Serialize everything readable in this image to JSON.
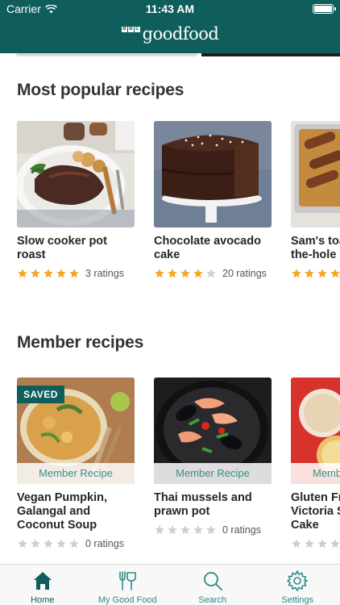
{
  "status_bar": {
    "carrier": "Carrier",
    "time": "11:43 AM"
  },
  "header": {
    "logo_bbc": [
      "B",
      "B",
      "C"
    ],
    "logo_text": "goodfood"
  },
  "sections": [
    {
      "title": "Most popular recipes",
      "cards": [
        {
          "name": "Slow cooker pot roast",
          "rating": 5,
          "ratings_text": "3 ratings"
        },
        {
          "name": "Chocolate avocado cake",
          "rating": 4,
          "ratings_text": "20 ratings"
        },
        {
          "name": "Sam's toad-in-the-hole",
          "visible_name": "Sam's toa\nthe-hole",
          "rating": 5,
          "ratings_text": ""
        }
      ]
    },
    {
      "title": "Member recipes",
      "cards": [
        {
          "name": "Vegan Pumpkin, Galangal and Coconut Soup",
          "badge": "SAVED",
          "band": "Member Recipe",
          "rating": 0,
          "ratings_text": "0 ratings"
        },
        {
          "name": "Thai mussels and prawn pot",
          "band": "Member Recipe",
          "rating": 0,
          "ratings_text": "0 ratings"
        },
        {
          "name": "Gluten Free Victoria Sponge Cake",
          "visible_name": "Gluten Fr\nVictoria S\nCake",
          "band": "Memb",
          "rating": 0,
          "ratings_text": ""
        }
      ]
    }
  ],
  "tabbar": {
    "items": [
      {
        "label": "Home",
        "icon": "home-icon",
        "active": true
      },
      {
        "label": "My Good Food",
        "icon": "cutlery-icon",
        "active": false
      },
      {
        "label": "Search",
        "icon": "search-icon",
        "active": false
      },
      {
        "label": "Settings",
        "icon": "gear-icon",
        "active": false
      }
    ]
  },
  "colors": {
    "brand": "#0f5e5c",
    "star": "#f5a623",
    "star_empty": "#cfcfcf",
    "accent_text": "#3a8f8b"
  }
}
